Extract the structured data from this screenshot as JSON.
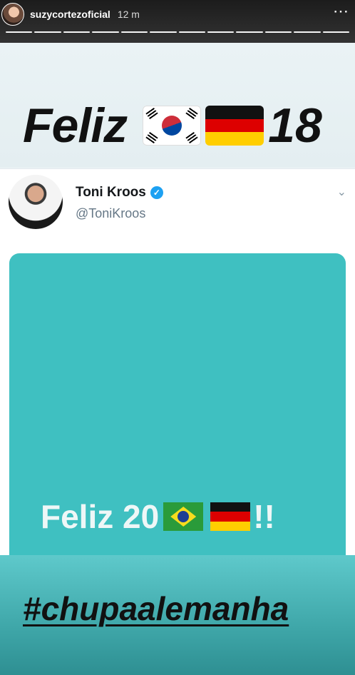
{
  "header": {
    "username": "suzycortezoficial",
    "time": "12 m",
    "more_icon": "more-dots-icon",
    "progress_segments": 12
  },
  "headline": {
    "word": "Feliz",
    "flags": [
      "south-korea-flag-icon",
      "germany-flag-icon"
    ],
    "number": "18"
  },
  "tweet": {
    "name": "Toni Kroos",
    "handle": "@ToniKroos",
    "verified_icon": "verified-badge-icon",
    "chevron_icon": "chevron-down-icon",
    "media": {
      "text": "Feliz 20",
      "flags": [
        "brazil-flag-icon",
        "germany-flag-icon"
      ],
      "suffix": "!!",
      "background": "#3fc0c1"
    }
  },
  "caption": {
    "hashtag": "#chupaalemanha"
  }
}
